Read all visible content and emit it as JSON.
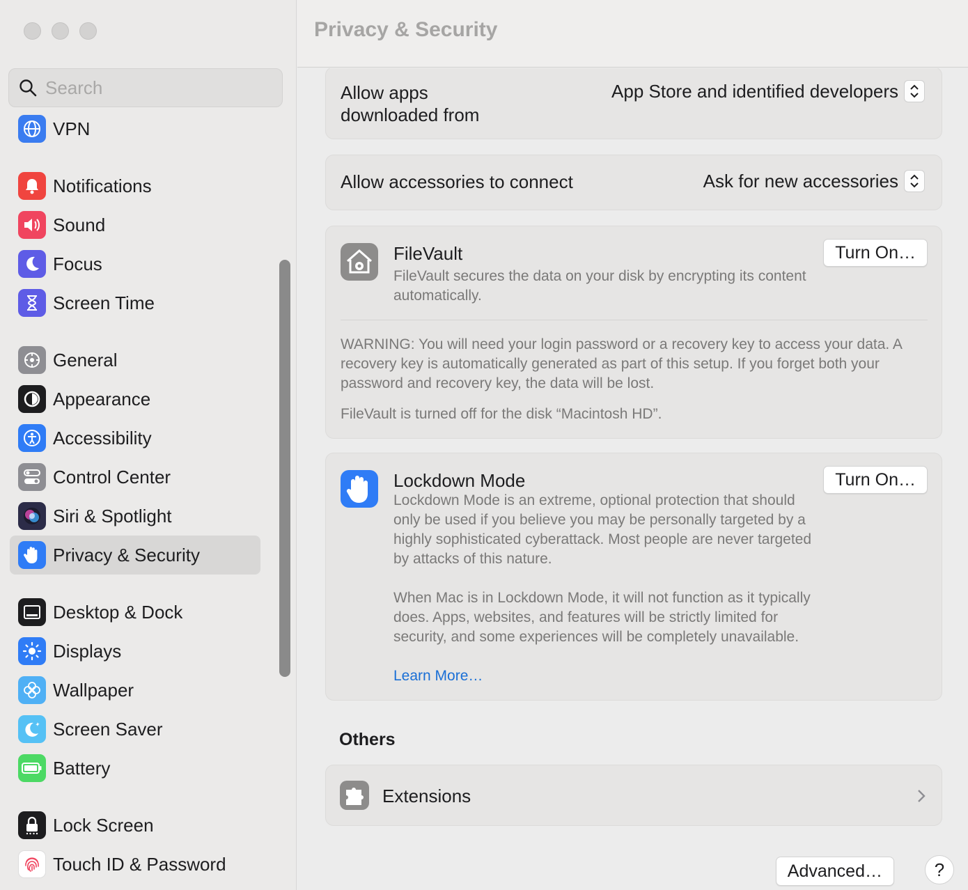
{
  "window": {
    "title": "Privacy & Security"
  },
  "search": {
    "placeholder": "Search"
  },
  "sidebar": {
    "items": [
      {
        "label": "VPN",
        "icon": "globe-icon",
        "color": "#3a7cf0"
      },
      {
        "label": "Notifications",
        "icon": "bell-icon",
        "color": "#f0453f"
      },
      {
        "label": "Sound",
        "icon": "speaker-icon",
        "color": "#f0455f"
      },
      {
        "label": "Focus",
        "icon": "moon-icon",
        "color": "#5e5ce6"
      },
      {
        "label": "Screen Time",
        "icon": "hourglass-icon",
        "color": "#5e5ce6"
      },
      {
        "label": "General",
        "icon": "gear-icon",
        "color": "#8e8e93"
      },
      {
        "label": "Appearance",
        "icon": "appearance-icon",
        "color": "#1d1d1f"
      },
      {
        "label": "Accessibility",
        "icon": "accessibility-icon",
        "color": "#2f7cf6"
      },
      {
        "label": "Control Center",
        "icon": "toggles-icon",
        "color": "#8e8e93"
      },
      {
        "label": "Siri & Spotlight",
        "icon": "siri-icon",
        "color": "#2c2c48"
      },
      {
        "label": "Privacy & Security",
        "icon": "hand-icon",
        "color": "#2f7cf6"
      },
      {
        "label": "Desktop & Dock",
        "icon": "dock-icon",
        "color": "#1d1d1f"
      },
      {
        "label": "Displays",
        "icon": "sun-icon",
        "color": "#2f7cf6"
      },
      {
        "label": "Wallpaper",
        "icon": "flower-icon",
        "color": "#4fb0f5"
      },
      {
        "label": "Screen Saver",
        "icon": "screensaver-icon",
        "color": "#55c1f5"
      },
      {
        "label": "Battery",
        "icon": "battery-icon",
        "color": "#4cd964"
      },
      {
        "label": "Lock Screen",
        "icon": "lock-icon",
        "color": "#1d1d1f"
      },
      {
        "label": "Touch ID & Password",
        "icon": "fingerprint-icon",
        "color": "#ffffff"
      }
    ]
  },
  "security": {
    "allow_apps_label": "Allow apps\ndownloaded from",
    "allow_apps_value": "App Store and identified developers",
    "accessories_label": "Allow accessories to connect",
    "accessories_value": "Ask for new accessories"
  },
  "filevault": {
    "title": "FileVault",
    "description": "FileVault secures the data on your disk by encrypting its content automatically.",
    "button": "Turn On…",
    "warning": "WARNING: You will need your login password or a recovery key to access your data. A recovery key is automatically generated as part of this setup. If you forget both your password and recovery key, the data will be lost.",
    "status": "FileVault is turned off for the disk “Macintosh HD”."
  },
  "lockdown": {
    "title": "Lockdown Mode",
    "description1": "Lockdown Mode is an extreme, optional protection that should only be used if you believe you may be personally targeted by a highly sophisticated cyberattack. Most people are never targeted by attacks of this nature.",
    "description2": "When Mac is in Lockdown Mode, it will not function as it typically does. Apps, websites, and features will be strictly limited for security, and some experiences will be completely unavailable.",
    "link": "Learn More…",
    "button": "Turn On…"
  },
  "others": {
    "heading": "Others",
    "extensions_label": "Extensions"
  },
  "footer": {
    "advanced_button": "Advanced…",
    "help_button": "?"
  },
  "colors": {
    "accent": "#2f7cf6",
    "link": "#1a6fd6",
    "sidebar_bg": "#ebeae9",
    "selected": "#d8d7d6"
  }
}
